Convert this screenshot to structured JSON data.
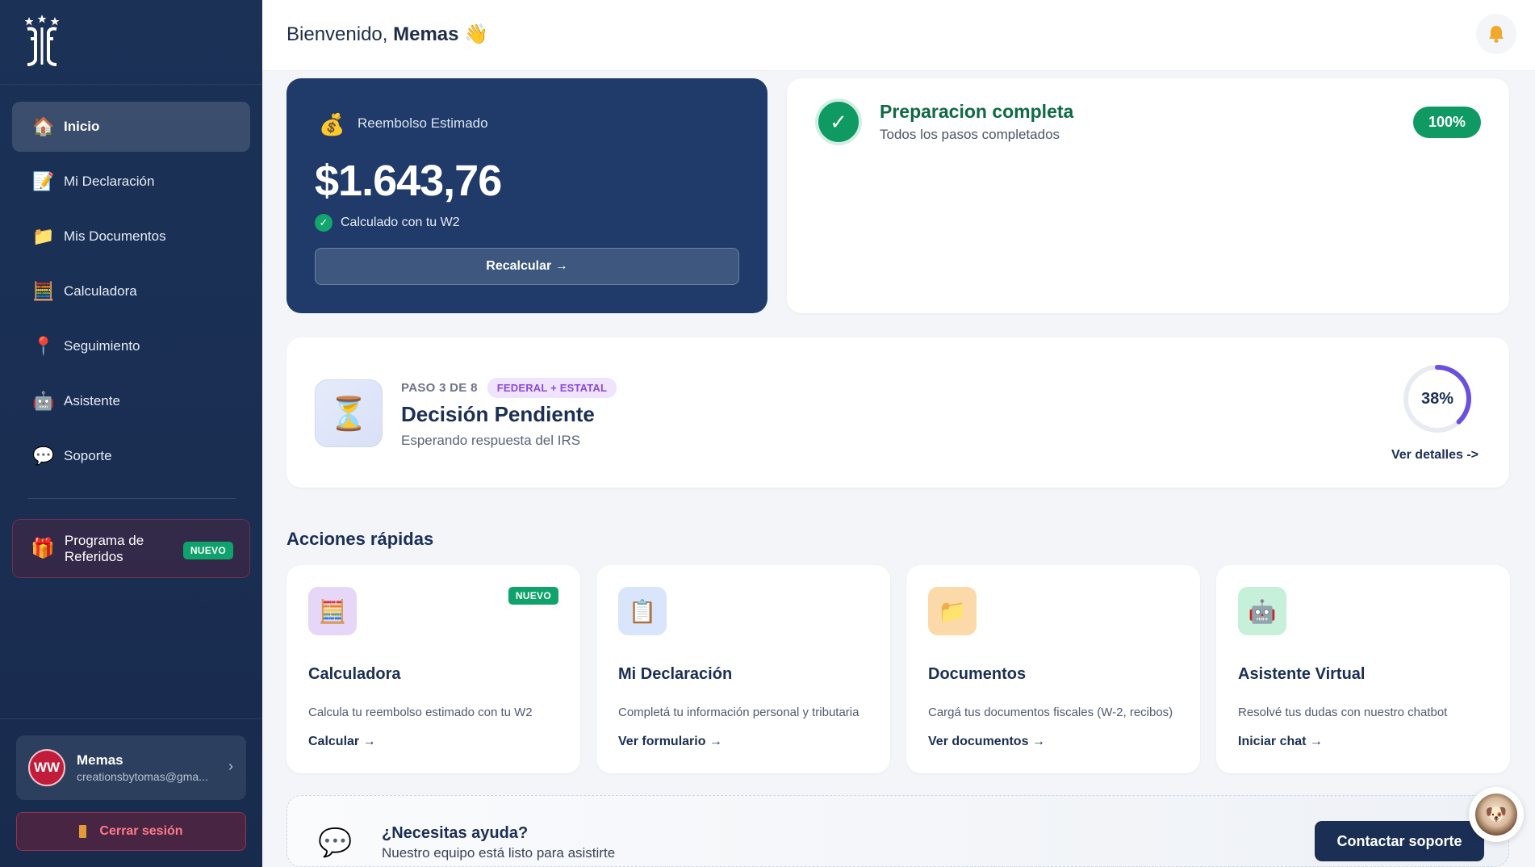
{
  "sidebar": {
    "logo": "logo-icon",
    "items": [
      {
        "label": "Inicio",
        "icon": "house-icon",
        "active": true
      },
      {
        "label": "Mi Declaración",
        "icon": "document-pen-icon"
      },
      {
        "label": "Mis Documentos",
        "icon": "folder-icon"
      },
      {
        "label": "Calculadora",
        "icon": "abacus-icon"
      },
      {
        "label": "Seguimiento",
        "icon": "pin-icon"
      },
      {
        "label": "Asistente",
        "icon": "robot-icon"
      },
      {
        "label": "Soporte",
        "icon": "speech-bubble-icon"
      }
    ],
    "referral": {
      "label": "Programa de Referidos",
      "badge": "NUEVO",
      "icon": "gift-icon"
    },
    "user": {
      "initials": "WW",
      "name": "Memas",
      "email": "creationsbytomas@gma..."
    },
    "logout": "Cerrar sesión"
  },
  "header": {
    "greeting": "Bienvenido,",
    "name": "Memas",
    "wave": "👋"
  },
  "refund": {
    "label": "Reembolso Estimado",
    "amount": "$1.643,76",
    "note": "Calculado con tu W2",
    "button": "Recalcular →"
  },
  "preparation": {
    "title": "Preparacion completa",
    "subtitle": "Todos los pasos completados",
    "percent": "100%"
  },
  "status": {
    "step": "PASO 3 DE 8",
    "badge": "FEDERAL + ESTATAL",
    "title": "Decisión Pendiente",
    "subtitle": "Esperando respuesta del IRS",
    "progress_label": "38%",
    "progress": 0.38,
    "link": "Ver detalles ->"
  },
  "quick_actions": {
    "title": "Acciones rápidas",
    "items": [
      {
        "title": "Calculadora",
        "desc": "Calcula tu reembolso estimado con tu W2",
        "link": "Calcular →",
        "badge": "NUEVO",
        "icon": "abacus-icon",
        "color": "#e6d6f7"
      },
      {
        "title": "Mi Declaración",
        "desc": "Completá tu información personal y tributaria",
        "link": "Ver formulario →",
        "icon": "clipboard-icon",
        "color": "#d9e5fb"
      },
      {
        "title": "Documentos",
        "desc": "Cargá tus documentos fiscales (W-2, recibos)",
        "link": "Ver documentos →",
        "icon": "folder-icon",
        "color": "#fcd9a8"
      },
      {
        "title": "Asistente Virtual",
        "desc": "Resolvé tus dudas con nuestro chatbot",
        "link": "Iniciar chat →",
        "icon": "robot-icon",
        "color": "#c6f0d9"
      }
    ]
  },
  "help": {
    "title": "¿Necesitas ayuda?",
    "subtitle": "Nuestro equipo está listo para asistirte",
    "button": "Contactar soporte"
  },
  "colors": {
    "sidebar": "#1b3156",
    "refund_card": "#203b6a",
    "success": "#0f9a63",
    "navy_text": "#1b2f55",
    "purple_badge": "#8b4ad6"
  }
}
